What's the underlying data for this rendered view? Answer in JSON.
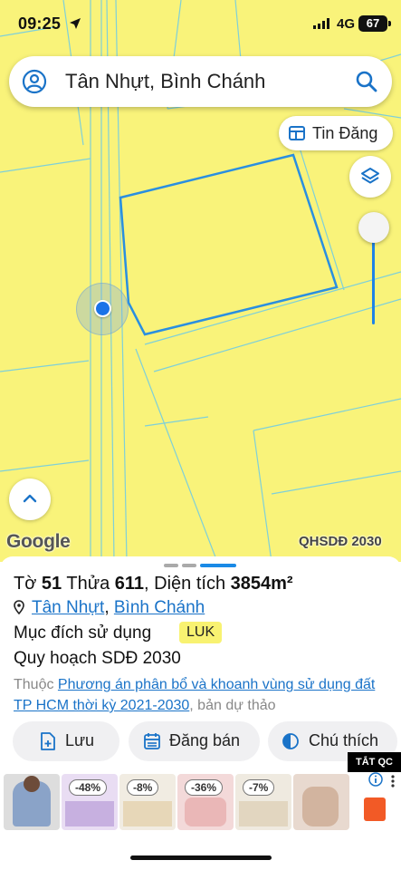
{
  "status_bar": {
    "time": "09:25",
    "network": "4G",
    "battery": "67"
  },
  "search": {
    "query": "Tân Nhựt, Bình Chánh"
  },
  "map": {
    "tin_dang_label": "Tin Đăng",
    "google_logo": "Google",
    "layer_label": "QHSDĐ 2030",
    "background_color": "#f9f37a",
    "parcel_outline_color": "#2a8fe0"
  },
  "parcel": {
    "to_label": "Tờ",
    "to_value": "51",
    "thua_label": "Thửa",
    "thua_value": "611",
    "area_label": ", Diện tích",
    "area_value": "3854m²",
    "ward_link": "Tân Nhựt",
    "separator": ",",
    "district_link": "Bình Chánh",
    "purpose_label": "Mục đích sử dụng",
    "purpose_code": "LUK",
    "plan_label": "Quy hoạch SDĐ 2030",
    "belongs_prefix": "Thuộc",
    "plan_link": "Phương án phân bổ và khoanh vùng sử dụng đất TP HCM thời kỳ 2021-2030",
    "belongs_suffix": ", bản dự thảo"
  },
  "actions": {
    "save_label": "Lưu",
    "post_label": "Đăng bán",
    "legend_label": "Chú thích"
  },
  "ads": {
    "close_label": "TẮT QC",
    "discounts": [
      "-48%",
      "-8%",
      "-36%",
      "-7%"
    ]
  }
}
